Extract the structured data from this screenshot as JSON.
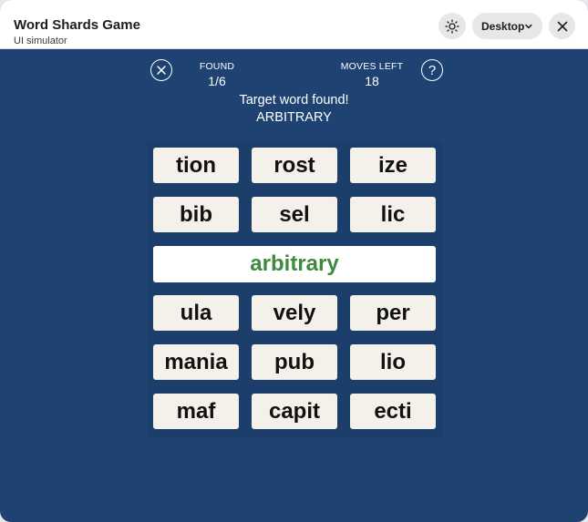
{
  "window": {
    "title": "Word Shards Game",
    "subtitle": "UI simulator",
    "device": "Desktop",
    "icons": [
      "sun-icon",
      "chevron-down-icon",
      "close-icon"
    ]
  },
  "header": {
    "found_label": "FOUND",
    "found_value": "1/6",
    "moves_label": "MOVES LEFT",
    "moves_value": "18",
    "help_glyph": "?"
  },
  "message": {
    "line1": "Target word found!",
    "line2": "ARBITRARY"
  },
  "board": {
    "rows_top": [
      [
        "tion",
        "rost",
        "ize"
      ],
      [
        "bib",
        "sel",
        "lic"
      ]
    ],
    "found_word": "arbitrary",
    "rows_bottom": [
      [
        "ula",
        "vely",
        "per"
      ],
      [
        "mania",
        "pub",
        "lio"
      ],
      [
        "maf",
        "capit",
        "ecti"
      ]
    ]
  },
  "colors": {
    "background": "#1e4373",
    "tile": "#f4f1eb",
    "found_word_text": "#3e8a3e"
  }
}
